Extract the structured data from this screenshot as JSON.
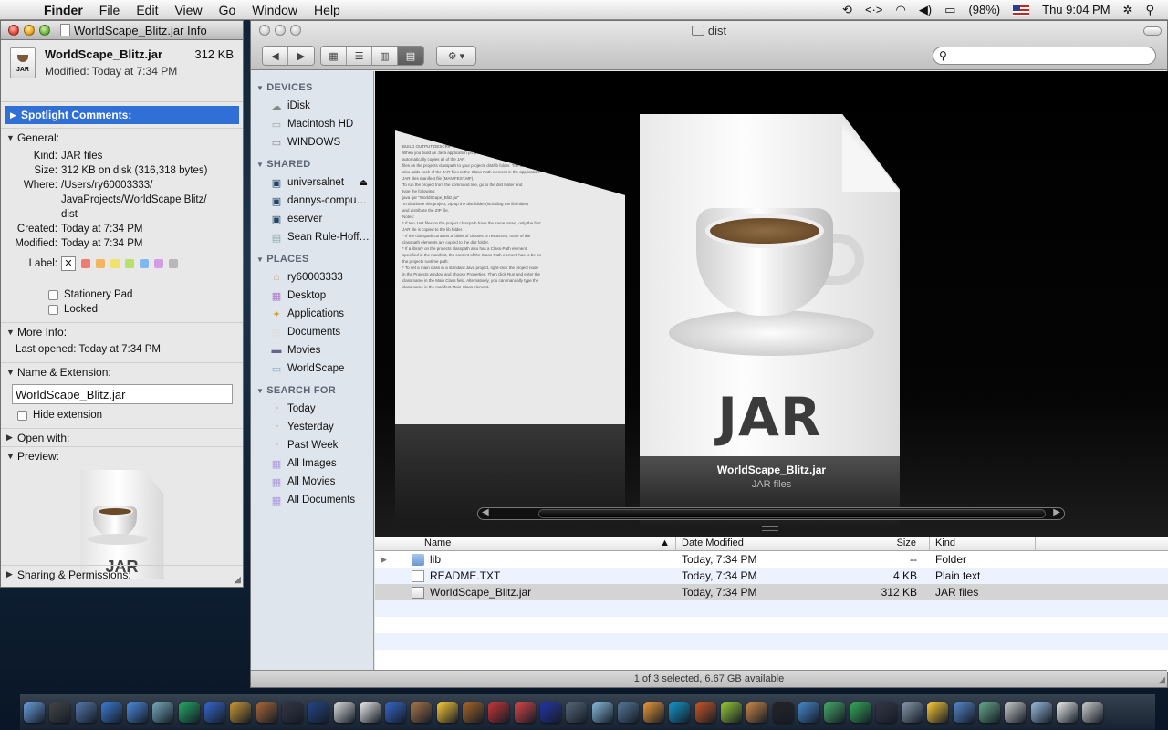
{
  "menubar": {
    "app": "Finder",
    "items": [
      "File",
      "Edit",
      "View",
      "Go",
      "Window",
      "Help"
    ],
    "battery": "(98%)",
    "clock": "Thu 9:04 PM"
  },
  "info": {
    "window_title": "WorldScape_Blitz.jar Info",
    "file_name": "WorldScape_Blitz.jar",
    "size": "312 KB",
    "modified": "Modified: Today at 7:34 PM",
    "spotlight": "Spotlight Comments:",
    "general": "General:",
    "kind_k": "Kind:",
    "kind": "JAR files",
    "size_k": "Size:",
    "size_full": "312 KB on disk (316,318 bytes)",
    "where_k": "Where:",
    "where1": "/Users/ry60003333/",
    "where2": "JavaProjects/WorldScape Blitz/",
    "where3": "dist",
    "created_k": "Created:",
    "created": "Today at 7:34 PM",
    "modified_k": "Modified:",
    "modified2": "Today at 7:34 PM",
    "label_k": "Label:",
    "label_x": "✕",
    "label_colors": [
      "#f07b72",
      "#f5b55c",
      "#f1e26a",
      "#b9e06a",
      "#7fb9f2",
      "#d59ce6",
      "#b8b8b8"
    ],
    "stationery": "Stationery Pad",
    "locked": "Locked",
    "more_info": "More Info:",
    "last_opened": "Last opened: Today at 7:34 PM",
    "name_ext": "Name & Extension:",
    "name_value": "WorldScape_Blitz.jar",
    "hide_ext": "Hide extension",
    "open_with": "Open with:",
    "preview": "Preview:",
    "preview_text": "JAR",
    "sharing": "Sharing & Permissions:"
  },
  "finder": {
    "title": "dist",
    "search_placeholder": "",
    "sidebar": {
      "devices": "DEVICES",
      "devices_items": [
        "iDisk",
        "Macintosh HD",
        "WINDOWS"
      ],
      "shared": "SHARED",
      "shared_items": [
        "universalnet",
        "dannys-compu…",
        "eserver",
        "Sean Rule-Hoff…"
      ],
      "places": "PLACES",
      "places_items": [
        "ry60003333",
        "Desktop",
        "Applications",
        "Documents",
        "Movies",
        "WorldScape"
      ],
      "search": "SEARCH FOR",
      "search_items": [
        "Today",
        "Yesterday",
        "Past Week",
        "All Images",
        "All Movies",
        "All Documents"
      ]
    },
    "coverflow": {
      "name": "WorldScape_Blitz.jar",
      "kind": "JAR files",
      "jar_text": "JAR",
      "doc_lines": [
        "BUILD OUTPUT DESCRIPTION",
        "When you build an Java application project that has a main class, the IDE",
        "automatically copies all of the JAR",
        "files on the projects classpath to your projects dist/lib folder. The IDE",
        "also adds each of the JAR files to the Class-Path element in the application",
        "JAR files manifest file (MANIFEST.MF).",
        "To run the project from the command line, go to the dist folder and",
        "type the following:",
        "java -jar \"WorldScape_Blitz.jar\"",
        "To distribute this project, zip up the dist folder (including the lib folder)",
        "and distribute the ZIP file.",
        "Notes:",
        "* If two JAR files on the project classpath have the same name, only the first",
        "JAR file is copied to the lib folder.",
        "* If the classpath contains a folder of classes or resources, none of the",
        "classpath elements are copied to the dist folder.",
        "* If a library on the projects classpath also has a Class-Path element",
        "specified in the manifest, the content of the Class-Path element has to be on",
        "the projects runtime path.",
        "* To set a main class in a standard Java project, right-click the project node",
        "in the Projects window and choose Properties. Then click Run and enter the",
        "class name in the Main Class field. Alternatively, you can manually type the",
        "class name in the manifest Main-Class element."
      ]
    },
    "columns": [
      "Name",
      "Date Modified",
      "Size",
      "Kind"
    ],
    "files": [
      {
        "name": "lib",
        "date": "Today, 7:34 PM",
        "size": "--",
        "kind": "Folder"
      },
      {
        "name": "README.TXT",
        "date": "Today, 7:34 PM",
        "size": "4 KB",
        "kind": "Plain text"
      },
      {
        "name": "WorldScape_Blitz.jar",
        "date": "Today, 7:34 PM",
        "size": "312 KB",
        "kind": "JAR files"
      }
    ],
    "status": "1 of 3 selected, 6.67 GB available"
  },
  "dock": {
    "icons": [
      "finder-icon",
      "dashboard-icon",
      "mail-icon",
      "safari-icon",
      "ichat-icon",
      "itunes-icon",
      "netnewswire-icon",
      "network-icon",
      "preview-icon",
      "photo-icon",
      "imovie-icon",
      "dvd-icon",
      "ical-icon",
      "textedit-icon",
      "quicktime-icon",
      "iphoto-icon",
      "adium-icon",
      "garageband-icon",
      "book-icon",
      "app-icon",
      "sonic-icon",
      "utility-icon",
      "bulb-icon",
      "monitor-icon",
      "box-icon",
      "skype-icon",
      "umbrella-icon",
      "game-icon",
      "transmission-icon",
      "terminal-icon",
      "quicktime2-icon",
      "xcode-icon",
      "timemachine-icon",
      "photo2-icon",
      "systempref-icon",
      "script-icon",
      "gear-icon",
      "chart-icon",
      "trash2-icon",
      "folder-icon",
      "docs-icon",
      "trash-icon"
    ]
  }
}
